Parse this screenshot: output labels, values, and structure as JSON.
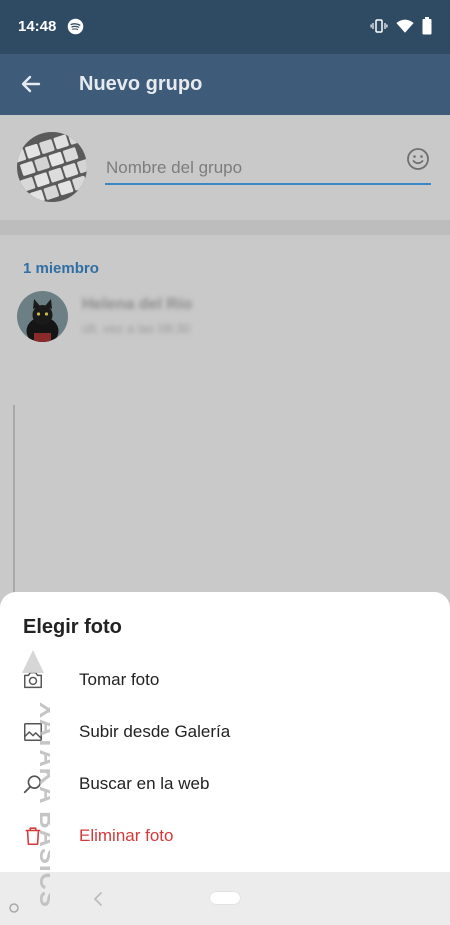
{
  "status_bar": {
    "time": "14:48",
    "icons": [
      "spotify-icon",
      "vibrate-icon",
      "wifi-icon",
      "battery-icon"
    ]
  },
  "app_bar": {
    "title": "Nuevo grupo",
    "back_icon": "arrow-left-icon",
    "background": "#3e5b79"
  },
  "group_form": {
    "name_placeholder": "Nombre del grupo",
    "name_value": "",
    "emoji_icon": "smiley-icon",
    "accent": "#3b86c4"
  },
  "members": {
    "count_label": "1 miembro",
    "items": [
      {
        "name": "Helena del Río",
        "status": "últ. vez a las 08:30"
      }
    ]
  },
  "sheet": {
    "title": "Elegir foto",
    "items": [
      {
        "label": "Tomar foto",
        "icon": "camera-icon"
      },
      {
        "label": "Subir desde Galería",
        "icon": "image-icon"
      },
      {
        "label": "Buscar en la web",
        "icon": "search-icon"
      },
      {
        "label": "Eliminar foto",
        "icon": "trash-icon",
        "color": "#d43a3a"
      }
    ]
  },
  "watermark": {
    "text": "XATAKA BASICS"
  }
}
